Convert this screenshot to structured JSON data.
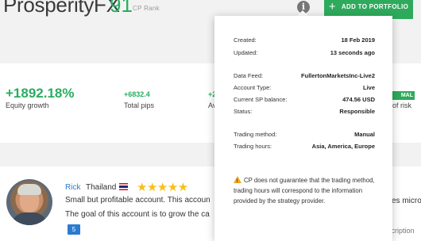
{
  "header": {
    "title": "ProsperityFX",
    "rank_value": "91",
    "rank_label": "CP Rank",
    "info_icon": "info-icon",
    "add_button_label": "ADD TO PORTFOLIO"
  },
  "stats": {
    "equity_growth_value": "+1892.18%",
    "equity_growth_label": "Equity growth",
    "total_pips_value": "+6832.4",
    "total_pips_label": "Total pips",
    "partial_value": "+2",
    "partial_label": "Av",
    "risk_badge": "MAL",
    "risk_label": "of risk"
  },
  "review": {
    "name": "Rick",
    "country": "Thailand",
    "stars": "★★★★★",
    "rating": 5,
    "line1": "Small but profitable account. This accoun",
    "line2": "The goal of this account is to grow the ca",
    "comments_count": "5",
    "right_fragment_1": "es micro",
    "right_fragment_2": "escription"
  },
  "popover": {
    "created_label": "Created:",
    "created_value": "18 Feb 2019",
    "updated_label": "Updated:",
    "updated_value": "13 seconds ago",
    "data_feed_label": "Data Feed:",
    "data_feed_value": "FullertonMarketsInc-Live2",
    "account_type_label": "Account Type:",
    "account_type_value": "Live",
    "sp_balance_label": "Current SP balance:",
    "sp_balance_value": "474.56 USD",
    "status_label": "Status:",
    "status_value": "Responsible",
    "trading_method_label": "Trading method:",
    "trading_method_value": "Manual",
    "trading_hours_label": "Trading hours:",
    "trading_hours_value": "Asia, America, Europe",
    "notice_text": "CP does not guarantee that the trading method, trading hours will correspond to the information provided by the strategy provider."
  },
  "colors": {
    "accent_green": "#2eaa5c",
    "link_blue": "#2b7bd0",
    "star_gold": "#f5c01a",
    "warning_orange": "#f0a623"
  }
}
